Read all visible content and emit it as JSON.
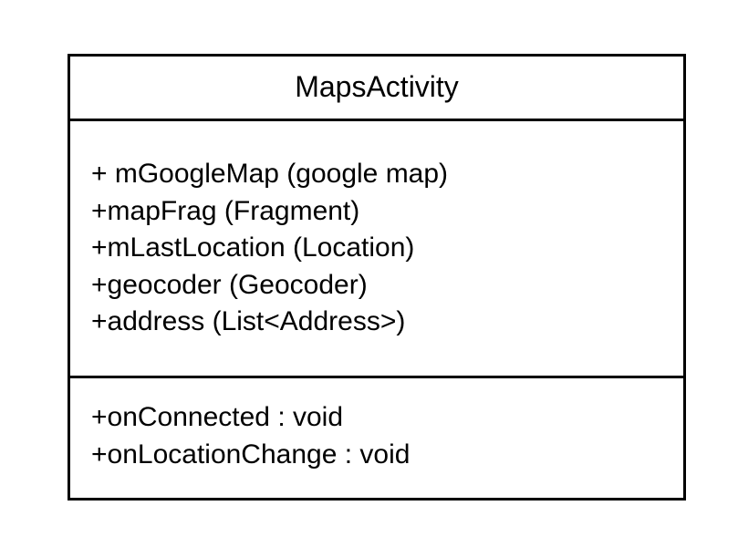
{
  "uml_class": {
    "name": "MapsActivity",
    "attributes": [
      "+ mGoogleMap (google map)",
      "+mapFrag (Fragment)",
      "+mLastLocation (Location)",
      "+geocoder (Geocoder)",
      "+address (List<Address>)"
    ],
    "methods": [
      "+onConnected : void",
      "+onLocationChange : void"
    ]
  },
  "colors": {
    "border": "#000000",
    "text": "#000000",
    "background": "#ffffff"
  }
}
